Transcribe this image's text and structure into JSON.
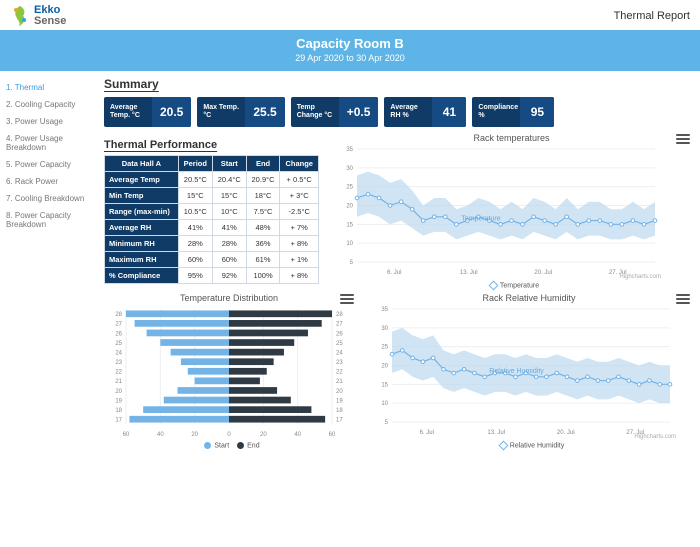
{
  "header": {
    "brand_a": "Ekko",
    "brand_b": "Sense",
    "report_title": "Thermal Report"
  },
  "banner": {
    "title": "Capacity Room B",
    "subtitle": "29 Apr 2020 to 30 Apr 2020"
  },
  "sidebar": {
    "items": [
      {
        "label": "1. Thermal",
        "active": true
      },
      {
        "label": "2. Cooling Capacity"
      },
      {
        "label": "3. Power Usage"
      },
      {
        "label": "4. Power Usage Breakdown"
      },
      {
        "label": "5. Power Capacity"
      },
      {
        "label": "6. Rack Power"
      },
      {
        "label": "7. Cooling Breakdown"
      },
      {
        "label": "8. Power Capacity Breakdown"
      }
    ]
  },
  "summary": {
    "heading": "Summary",
    "tiles": [
      {
        "label": "Average Temp. °C",
        "value": "20.5"
      },
      {
        "label": "Max Temp. °C",
        "value": "25.5"
      },
      {
        "label": "Temp Change °C",
        "value": "+0.5"
      },
      {
        "label": "Average RH %",
        "value": "41"
      },
      {
        "label": "Compliance %",
        "value": "95"
      }
    ]
  },
  "thermal": {
    "heading": "Thermal Performance",
    "columns": [
      "Data Hall A",
      "Period",
      "Start",
      "End",
      "Change"
    ],
    "rows": [
      {
        "h": "Average Temp",
        "c": [
          "20.5°C",
          "20.4°C",
          "20.9°C",
          "+ 0.5°C"
        ]
      },
      {
        "h": "Min Temp",
        "c": [
          "15°C",
          "15°C",
          "18°C",
          "+ 3°C"
        ]
      },
      {
        "h": "Range (max-min)",
        "c": [
          "10.5°C",
          "10°C",
          "7.5°C",
          "-2.5°C"
        ]
      },
      {
        "h": "Average RH",
        "c": [
          "41%",
          "41%",
          "48%",
          "+ 7%"
        ]
      },
      {
        "h": "Minimum RH",
        "c": [
          "28%",
          "28%",
          "36%",
          "+ 8%"
        ]
      },
      {
        "h": "Maximum RH",
        "c": [
          "60%",
          "60%",
          "61%",
          "+ 1%"
        ]
      },
      {
        "h": "% Compliance",
        "c": [
          "95%",
          "92%",
          "100%",
          "+ 8%"
        ]
      }
    ]
  },
  "chart_data": [
    {
      "id": "rack_temp",
      "type": "line",
      "title": "Rack temperatures",
      "ylabel": "",
      "xlabel": "",
      "ylim": [
        5,
        35
      ],
      "yticks": [
        5,
        10,
        15,
        20,
        25,
        30,
        35
      ],
      "xticks": [
        "6. Jul",
        "13. Jul",
        "20. Jul",
        "27. Jul"
      ],
      "series": [
        {
          "name": "Temperature",
          "values": [
            22,
            23,
            22,
            20,
            21,
            19,
            16,
            17,
            17,
            15,
            16,
            17,
            16,
            15,
            16,
            15,
            17,
            16,
            15,
            17,
            15,
            16,
            16,
            15,
            15,
            16,
            15,
            16
          ]
        }
      ],
      "band": {
        "low": [
          17,
          18,
          17,
          15,
          16,
          14,
          12,
          13,
          13,
          11,
          12,
          13,
          12,
          11,
          12,
          11,
          13,
          12,
          11,
          13,
          11,
          12,
          12,
          11,
          11,
          12,
          11,
          12
        ],
        "high": [
          28,
          29,
          28,
          26,
          27,
          24,
          20,
          22,
          22,
          19,
          20,
          22,
          21,
          19,
          21,
          19,
          22,
          21,
          19,
          22,
          19,
          21,
          21,
          19,
          19,
          21,
          19,
          21
        ]
      },
      "annotation": "Temperature",
      "credit": "Highcharts.com",
      "legend": [
        "Temperature"
      ]
    },
    {
      "id": "temp_dist",
      "type": "bar",
      "title": "Temperature Distribution",
      "categories": [
        "28",
        "27",
        "26",
        "25",
        "24",
        "23",
        "22",
        "21",
        "20",
        "19",
        "18",
        "17"
      ],
      "series": [
        {
          "name": "Start",
          "values": [
            60,
            55,
            48,
            40,
            34,
            28,
            24,
            20,
            30,
            38,
            50,
            58
          ]
        },
        {
          "name": "End",
          "values": [
            60,
            54,
            46,
            38,
            32,
            26,
            22,
            18,
            28,
            36,
            48,
            56
          ]
        }
      ],
      "xticks": [
        "60",
        "40",
        "20",
        "0",
        "20",
        "40",
        "60"
      ],
      "legend": [
        "Start",
        "End"
      ]
    },
    {
      "id": "rack_rh",
      "type": "line",
      "title": "Rack Relative Humidity",
      "ylim": [
        5,
        35
      ],
      "yticks": [
        5,
        10,
        15,
        20,
        25,
        30,
        35
      ],
      "xticks": [
        "6. Jul",
        "13. Jul",
        "20. Jul",
        "27. Jul"
      ],
      "series": [
        {
          "name": "Relative Humidity",
          "values": [
            23,
            24,
            22,
            21,
            22,
            19,
            18,
            19,
            18,
            17,
            18,
            18,
            17,
            18,
            17,
            17,
            18,
            17,
            16,
            17,
            16,
            16,
            17,
            16,
            15,
            16,
            15,
            15
          ]
        }
      ],
      "band": {
        "low": [
          18,
          19,
          17,
          16,
          17,
          14,
          13,
          14,
          13,
          12,
          13,
          13,
          12,
          13,
          12,
          12,
          13,
          12,
          11,
          12,
          11,
          11,
          12,
          11,
          10,
          11,
          10,
          10
        ],
        "high": [
          29,
          30,
          28,
          27,
          28,
          24,
          23,
          24,
          23,
          22,
          23,
          23,
          22,
          23,
          22,
          22,
          23,
          22,
          21,
          22,
          21,
          21,
          22,
          21,
          20,
          21,
          20,
          20
        ]
      },
      "annotation": "Relative Humidity",
      "credit": "Highcharts.com",
      "legend": [
        "Relative Humidity"
      ]
    }
  ]
}
